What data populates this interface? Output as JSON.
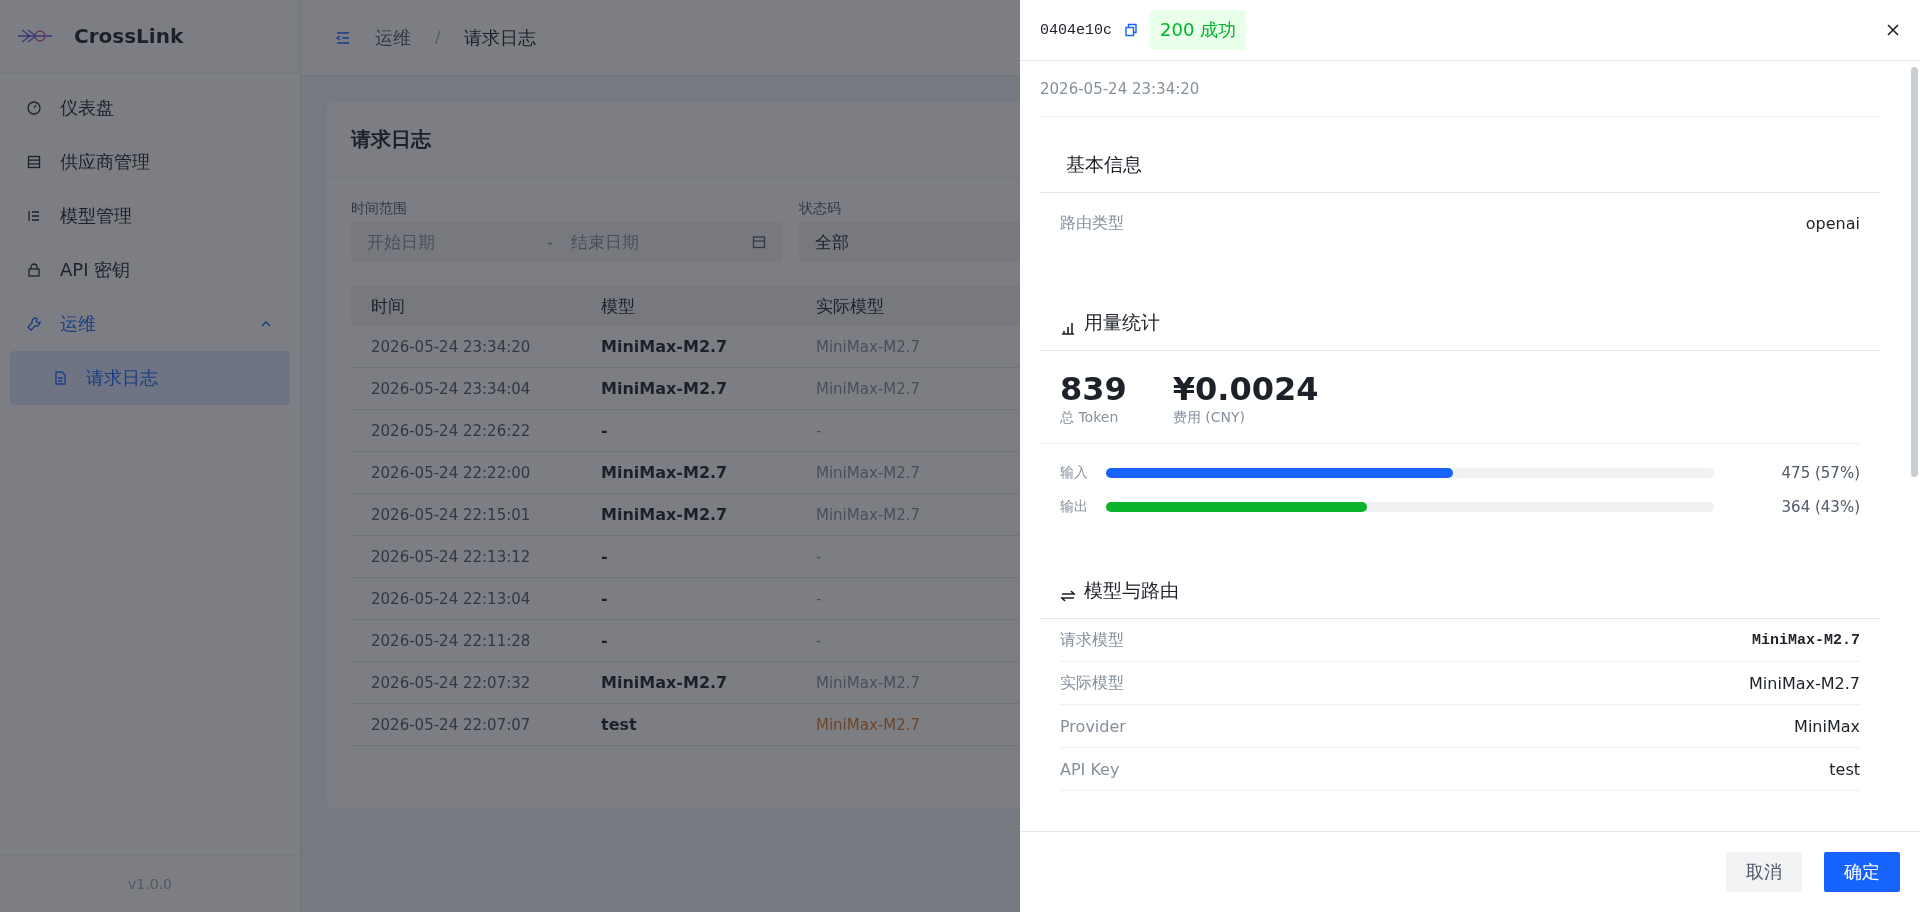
{
  "app": {
    "name": "CrossLink",
    "version": "v1.0.0"
  },
  "sidebar": {
    "items": [
      {
        "label": "仪表盘",
        "selected": false
      },
      {
        "label": "供应商管理",
        "selected": false
      },
      {
        "label": "模型管理",
        "selected": false
      },
      {
        "label": "API 密钥",
        "selected": false
      },
      {
        "label": "运维",
        "selected": false,
        "expanded": true,
        "children": [
          {
            "label": "请求日志",
            "selected": true
          }
        ]
      }
    ]
  },
  "breadcrumb": {
    "separator": "/",
    "items": [
      "运维",
      "请求日志"
    ]
  },
  "page": {
    "title": "请求日志",
    "filters": [
      {
        "kind": "daterange",
        "label": "时间范围",
        "start_placeholder": "开始日期",
        "separator": "-",
        "end_placeholder": "结束日期"
      },
      {
        "kind": "select",
        "label": "状态码",
        "value": "全部"
      }
    ],
    "table": {
      "columns": [
        "时间",
        "模型",
        "实际模型"
      ],
      "rows": [
        {
          "time": "2026-05-24 23:34:20",
          "model": "MiniMax-M2.7",
          "actual_model": "MiniMax-M2.7",
          "highlighted": false
        },
        {
          "time": "2026-05-24 23:34:04",
          "model": "MiniMax-M2.7",
          "actual_model": "MiniMax-M2.7",
          "highlighted": false
        },
        {
          "time": "2026-05-24 22:26:22",
          "model": "-",
          "actual_model": "-",
          "highlighted": false
        },
        {
          "time": "2026-05-24 22:22:00",
          "model": "MiniMax-M2.7",
          "actual_model": "MiniMax-M2.7",
          "highlighted": false
        },
        {
          "time": "2026-05-24 22:15:01",
          "model": "MiniMax-M2.7",
          "actual_model": "MiniMax-M2.7",
          "highlighted": false
        },
        {
          "time": "2026-05-24 22:13:12",
          "model": "-",
          "actual_model": "-",
          "highlighted": false
        },
        {
          "time": "2026-05-24 22:13:04",
          "model": "-",
          "actual_model": "-",
          "highlighted": false
        },
        {
          "time": "2026-05-24 22:11:28",
          "model": "-",
          "actual_model": "-",
          "highlighted": false
        },
        {
          "time": "2026-05-24 22:07:32",
          "model": "MiniMax-M2.7",
          "actual_model": "MiniMax-M2.7",
          "highlighted": false
        },
        {
          "time": "2026-05-24 22:07:07",
          "model": "test",
          "actual_model": "MiniMax-M2.7",
          "highlighted": true
        }
      ]
    }
  },
  "drawer": {
    "request_id": "0404e10c",
    "status": "200 成功",
    "timestamp": "2026-05-24 23:34:20",
    "sections": [
      {
        "kind": "fields",
        "title": "基本信息",
        "fields": [
          {
            "label": "路由类型",
            "value": "openai",
            "mono": false
          }
        ]
      },
      {
        "kind": "usage",
        "title": "用量统计",
        "total_tokens": "839",
        "total_label": "总 Token",
        "cost": "¥0.0024",
        "cost_label": "费用 (CNY)",
        "bars": [
          {
            "label": "输入",
            "level": 0.57,
            "reading": "475 (57%)",
            "color": "#1763ff"
          },
          {
            "label": "输出",
            "level": 0.43,
            "reading": "364 (43%)",
            "color": "#0bb52b"
          }
        ]
      },
      {
        "kind": "fields",
        "title": "模型与路由",
        "fields": [
          {
            "label": "请求模型",
            "value": "MiniMax-M2.7",
            "mono": true
          },
          {
            "label": "实际模型",
            "value": "MiniMax-M2.7",
            "mono": false
          },
          {
            "label": "Provider",
            "value": "MiniMax",
            "mono": false
          },
          {
            "label": "API Key",
            "value": "test",
            "mono": false
          }
        ]
      }
    ],
    "buttons": [
      {
        "label": "取消",
        "primary": false
      },
      {
        "label": "确定",
        "primary": true
      }
    ]
  }
}
